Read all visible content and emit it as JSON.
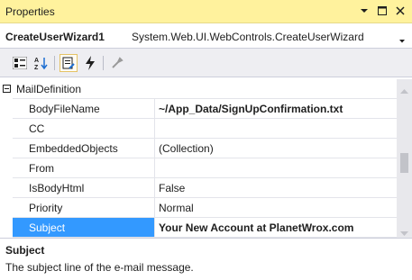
{
  "window": {
    "title": "Properties"
  },
  "object": {
    "name": "CreateUserWizard1",
    "type": "System.Web.UI.WebControls.CreateUserWizard"
  },
  "toolbar": {
    "buttons": [
      "categorized-icon",
      "alphabetical-icon",
      "properties-icon",
      "events-icon",
      "property-pages-icon"
    ]
  },
  "grid": {
    "category": "MailDefinition",
    "rows": [
      {
        "name": "BodyFileName",
        "value": "~/App_Data/SignUpConfirmation.txt",
        "bold": true
      },
      {
        "name": "CC",
        "value": ""
      },
      {
        "name": "EmbeddedObjects",
        "value": "(Collection)"
      },
      {
        "name": "From",
        "value": ""
      },
      {
        "name": "IsBodyHtml",
        "value": "False"
      },
      {
        "name": "Priority",
        "value": "Normal"
      },
      {
        "name": "Subject",
        "value": "Your New Account at PlanetWrox.com",
        "bold": true,
        "selected": true
      }
    ]
  },
  "description": {
    "title": "Subject",
    "text": "The subject line of the e-mail message."
  },
  "colors": {
    "titlebar": "#fff29d",
    "selection": "#3399ff"
  }
}
